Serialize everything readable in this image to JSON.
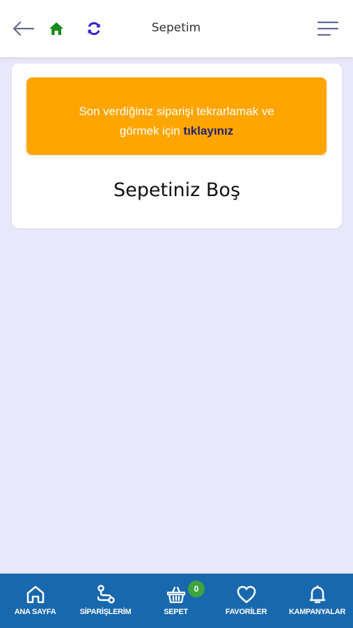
{
  "header": {
    "title": "Sepetim"
  },
  "banner": {
    "text_line1": "Son verdiğiniz siparişi tekrarlamak ve",
    "text_prefix": "görmek için ",
    "link_text": "tıklayınız"
  },
  "cart": {
    "empty_message": "Sepetiniz Boş"
  },
  "bottom_nav": {
    "items": [
      {
        "label": "ANA SAYFA",
        "icon": "home-outline-icon"
      },
      {
        "label": "SİPARİŞLERİM",
        "icon": "route-icon"
      },
      {
        "label": "SEPET",
        "icon": "basket-icon",
        "badge": "0"
      },
      {
        "label": "FAVORİLER",
        "icon": "heart-icon"
      },
      {
        "label": "KAMPANYALAR",
        "icon": "bell-icon"
      }
    ]
  },
  "colors": {
    "background": "#e9e8fa",
    "banner": "#ffa500",
    "banner_link": "#24226d",
    "nav_bar": "#1868ae",
    "badge": "#3fa33f",
    "home_icon": "#1a8a1a",
    "refresh_icon": "#2a1fd6"
  }
}
